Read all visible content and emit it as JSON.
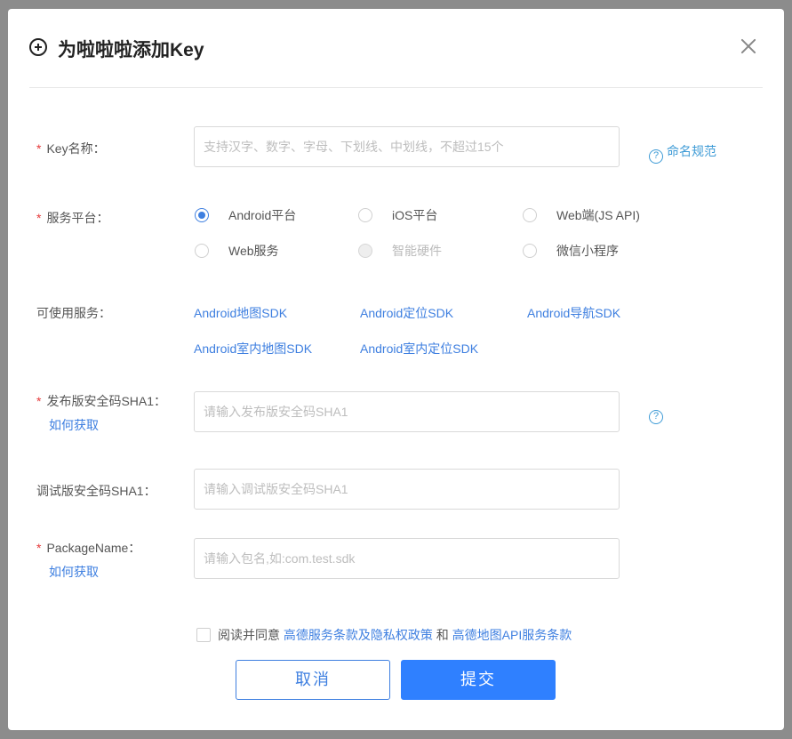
{
  "dialog": {
    "title": "为啦啦啦添加Key"
  },
  "required_mark": "*",
  "form": {
    "key_name": {
      "label": "Key名称：",
      "placeholder": "支持汉字、数字、字母、下划线、中划线，不超过15个",
      "value": "",
      "help_label": "命名规范"
    },
    "platform": {
      "label": "服务平台：",
      "options": [
        {
          "label": "Android平台",
          "state": "selected"
        },
        {
          "label": "iOS平台",
          "state": "unselected"
        },
        {
          "label": "Web端(JS API)",
          "state": "unselected"
        },
        {
          "label": "Web服务",
          "state": "unselected"
        },
        {
          "label": "智能硬件",
          "state": "disabled"
        },
        {
          "label": "微信小程序",
          "state": "unselected"
        }
      ]
    },
    "services": {
      "label": "可使用服务：",
      "items": [
        "Android地图SDK",
        "Android定位SDK",
        "Android导航SDK",
        "Android室内地图SDK",
        "Android室内定位SDK"
      ]
    },
    "release_sha1": {
      "label": "发布版安全码SHA1：",
      "link": "如何获取",
      "placeholder": "请输入发布版安全码SHA1",
      "value": ""
    },
    "debug_sha1": {
      "label": "调试版安全码SHA1：",
      "placeholder": "请输入调试版安全码SHA1",
      "value": ""
    },
    "package_name": {
      "label": "PackageName：",
      "link": "如何获取",
      "placeholder": "请输入包名,如:com.test.sdk",
      "value": ""
    }
  },
  "agreement": {
    "checked": false,
    "prefix": "阅读并同意",
    "link1": "高德服务条款及隐私权政策",
    "conjunction": "和",
    "link2": "高德地图API服务条款"
  },
  "buttons": {
    "cancel": "取消",
    "submit": "提交"
  },
  "colors": {
    "accent": "#3e7fe0",
    "primary_button": "#2f80ff",
    "required": "#e5393a",
    "help": "#3e9bd6",
    "overlay": "#8c8c8c"
  },
  "icons": {
    "title": "add-circle-icon",
    "close": "close-icon",
    "help": "question-circle-icon"
  }
}
